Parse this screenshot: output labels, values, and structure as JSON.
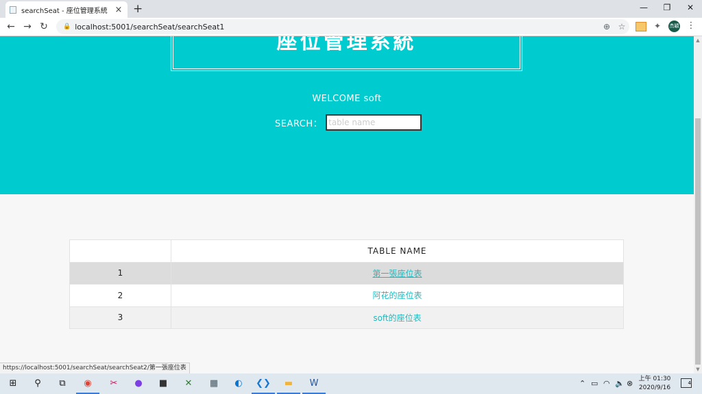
{
  "browser": {
    "tab_title": "searchSeat - 座位管理系統",
    "url": "localhost:5001/searchSeat/searchSeat1",
    "status_url": "https://localhost:5001/searchSeat/searchSeat2/第一張座位表",
    "avatar_text": "杰穎"
  },
  "hero": {
    "title": "座位管理系統",
    "welcome": "WELCOME soft",
    "search_label": "SEARCH：",
    "search_placeholder": "table name",
    "bg_color": "#00cccf"
  },
  "table": {
    "headers": [
      "",
      "TABLE NAME"
    ],
    "rows": [
      {
        "index": "1",
        "name": "第一張座位表"
      },
      {
        "index": "2",
        "name": "阿花的座位表"
      },
      {
        "index": "3",
        "name": "soft的座位表"
      }
    ],
    "link_color": "#1fb9bf"
  },
  "taskbar": {
    "clock_period_time": "上午 01:30",
    "clock_date": "2020/9/16",
    "notification_count": "4"
  }
}
